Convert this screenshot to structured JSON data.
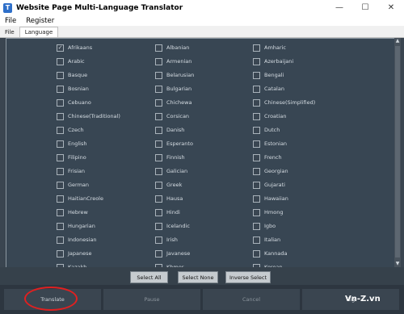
{
  "window": {
    "title": "Website Page Multi-Language Translator",
    "app_icon_glyph": "T"
  },
  "window_controls": {
    "minimize": "—",
    "maximize": "☐",
    "close": "✕"
  },
  "menu": [
    "File",
    "Register"
  ],
  "tabs": [
    {
      "label": "File",
      "active": false
    },
    {
      "label": "Language",
      "active": true
    }
  ],
  "languages": {
    "col1": [
      "Afrikaans",
      "Arabic",
      "Basque",
      "Bosnian",
      "Cebuano",
      "Chinese(Traditional)",
      "Czech",
      "English",
      "Filipino",
      "Frisian",
      "German",
      "HaitianCreole",
      "Hebrew",
      "Hungarian",
      "Indonesian",
      "Japanese",
      "Kazakh"
    ],
    "col2": [
      "Albanian",
      "Armenian",
      "Belarusian",
      "Bulgarian",
      "Chichewa",
      "Corsican",
      "Danish",
      "Esperanto",
      "Finnish",
      "Galician",
      "Greek",
      "Hausa",
      "Hindi",
      "Icelandic",
      "Irish",
      "Javanese",
      "Khmer"
    ],
    "col3": [
      "Amharic",
      "Azerbaijani",
      "Bengali",
      "Catalan",
      "Chinese(Simplified)",
      "Croatian",
      "Dutch",
      "Estonian",
      "French",
      "Georgian",
      "Gujarati",
      "Hawaiian",
      "Hmong",
      "Igbo",
      "Italian",
      "Kannada",
      "Korean"
    ],
    "checked": [
      "Afrikaans"
    ],
    "check_glyph": "✓"
  },
  "selection_buttons": {
    "select_all": "Select All",
    "select_none": "Select None",
    "inverse_select": "Inverse Select"
  },
  "action_buttons": {
    "translate": "Translate",
    "pause": "Pause",
    "cancel": "Cancel",
    "right_partial": "Rig"
  },
  "scrollbar": {
    "up": "▲",
    "down": "▼"
  },
  "watermark": "Vn-Z.vn",
  "colors": {
    "background": "#3a4550",
    "panel": "#384653",
    "highlight_ring": "#e02020",
    "app_icon": "#2e6fc9"
  }
}
